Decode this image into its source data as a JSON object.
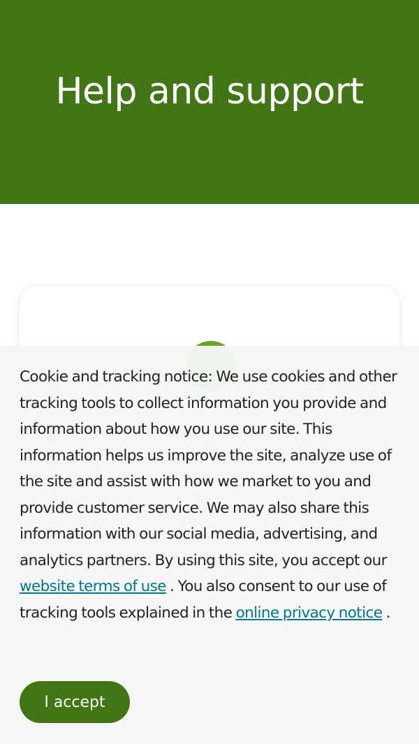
{
  "header": {
    "title": "Help and support"
  },
  "cookie_notice": {
    "text_part1": "Cookie and tracking notice: We use cookies and other tracking tools to collect information you provide and information about how you use our site. This information helps us improve the site, analyze use of the site and assist with how we market to you and provide customer service. We may also share this information with our social media, advertising, and analytics partners. By using this site, you accept our ",
    "terms_link": "website terms of use",
    "text_part2": " . You also consent to our use of tracking tools explained in the ",
    "privacy_link": "online privacy notice",
    "text_part3": " .",
    "accept_label": "I accept"
  },
  "colors": {
    "brand_green": "#417515",
    "link_teal": "#00778b",
    "icon_green": "#6da22a"
  }
}
